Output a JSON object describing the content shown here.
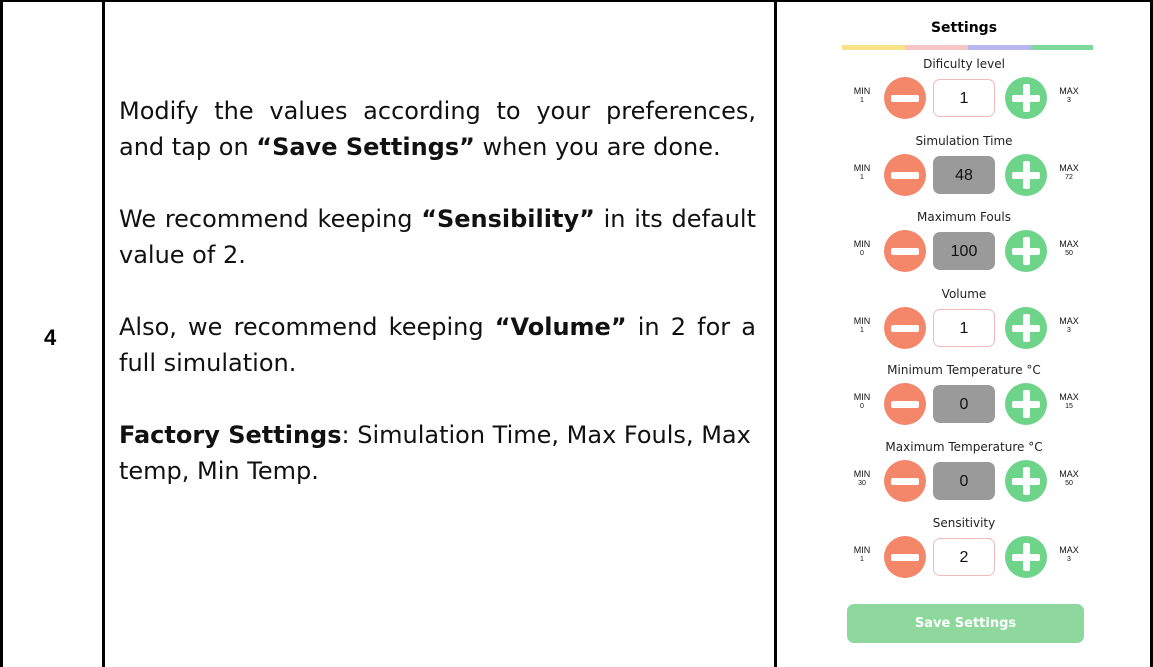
{
  "step": "4",
  "instructions": {
    "p1": {
      "pre": "Modify the values according to your preferences, and tap on ",
      "bold": "“Save Settings”",
      "post": " when you are done."
    },
    "p2": {
      "pre": "We recommend keeping ",
      "bold": "“Sensibility”",
      "post": " in its default value of 2."
    },
    "p3": {
      "pre": "Also, we recommend keeping ",
      "bold": "“Volume”",
      "post": " in 2 for a full simulation."
    },
    "p4": {
      "bold": "Factory Settings",
      "post": ": Simulation Time, Max Fouls, Max temp, Min Temp."
    }
  },
  "settings": {
    "title": "Settings",
    "color_bar": [
      "#f9e38a",
      "#f6c5c5",
      "#b8b6ef",
      "#7fd99a"
    ],
    "items": [
      {
        "label": "Dificulty level",
        "min_label": "MIN",
        "min": "1",
        "value": "1",
        "max_label": "MAX",
        "max": "3",
        "disabled": false
      },
      {
        "label": "Simulation Time",
        "min_label": "MIN",
        "min": "1",
        "value": "48",
        "max_label": "MAX",
        "max": "72",
        "disabled": true
      },
      {
        "label": "Maximum Fouls",
        "min_label": "MIN",
        "min": "0",
        "value": "100",
        "max_label": "MAX",
        "max": "50",
        "disabled": true
      },
      {
        "label": "Volume",
        "min_label": "MIN",
        "min": "1",
        "value": "1",
        "max_label": "MAX",
        "max": "3",
        "disabled": false
      },
      {
        "label": "Minimum Temperature °C",
        "min_label": "MIN",
        "min": "0",
        "value": "0",
        "max_label": "MAX",
        "max": "15",
        "disabled": true
      },
      {
        "label": "Maximum Temperature °C",
        "min_label": "MIN",
        "min": "30",
        "value": "0",
        "max_label": "MAX",
        "max": "50",
        "disabled": true
      },
      {
        "label": "Sensitivity",
        "min_label": "MIN",
        "min": "1",
        "value": "2",
        "max_label": "MAX",
        "max": "3",
        "disabled": false
      }
    ],
    "save_label": "Save Settings"
  }
}
